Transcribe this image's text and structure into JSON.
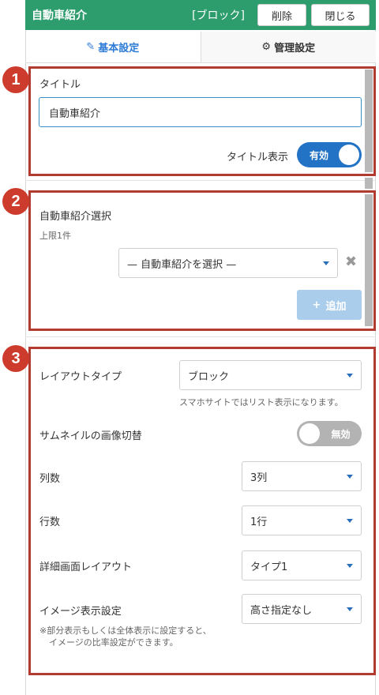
{
  "header": {
    "title": "自動車紹介",
    "tag": "[ブロック]",
    "delete_label": "削除",
    "close_label": "閉じる",
    "bg_color": "#2e9d6e"
  },
  "tabs": [
    {
      "label": "基本設定",
      "icon": "edit-icon",
      "active": true
    },
    {
      "label": "管理設定",
      "icon": "gear-icon",
      "active": false
    }
  ],
  "callouts": [
    "1",
    "2",
    "3"
  ],
  "section1": {
    "title_label": "タイトル",
    "title_value": "自動車紹介",
    "title_display_label": "タイトル表示",
    "toggle_label": "有効",
    "toggle_on": true
  },
  "section2": {
    "label": "自動車紹介選択",
    "limit_note": "上限1件",
    "select_value": "— 自動車紹介を選択 —",
    "clear_icon": "close-icon",
    "add_label": "追加"
  },
  "section3": {
    "layout_type_label": "レイアウトタイプ",
    "layout_type_value": "ブロック",
    "layout_note": "スマホサイトではリスト表示になります。",
    "thumb_switch_label": "サムネイルの画像切替",
    "thumb_toggle_label": "無効",
    "thumb_toggle_on": false,
    "columns_label": "列数",
    "columns_value": "3列",
    "rows_label": "行数",
    "rows_value": "1行",
    "detail_layout_label": "詳細画面レイアウト",
    "detail_layout_value": "タイプ1",
    "image_display_label": "イメージ表示設定",
    "image_display_value": "高さ指定なし",
    "image_note_line1": "※部分表示もしくは全体表示に設定すると、",
    "image_note_line2": "イメージの比率設定ができます。"
  },
  "colors": {
    "accent_blue": "#2273c5",
    "callout_red": "#cc3b2c",
    "add_button_disabled": "#a9cdea"
  }
}
